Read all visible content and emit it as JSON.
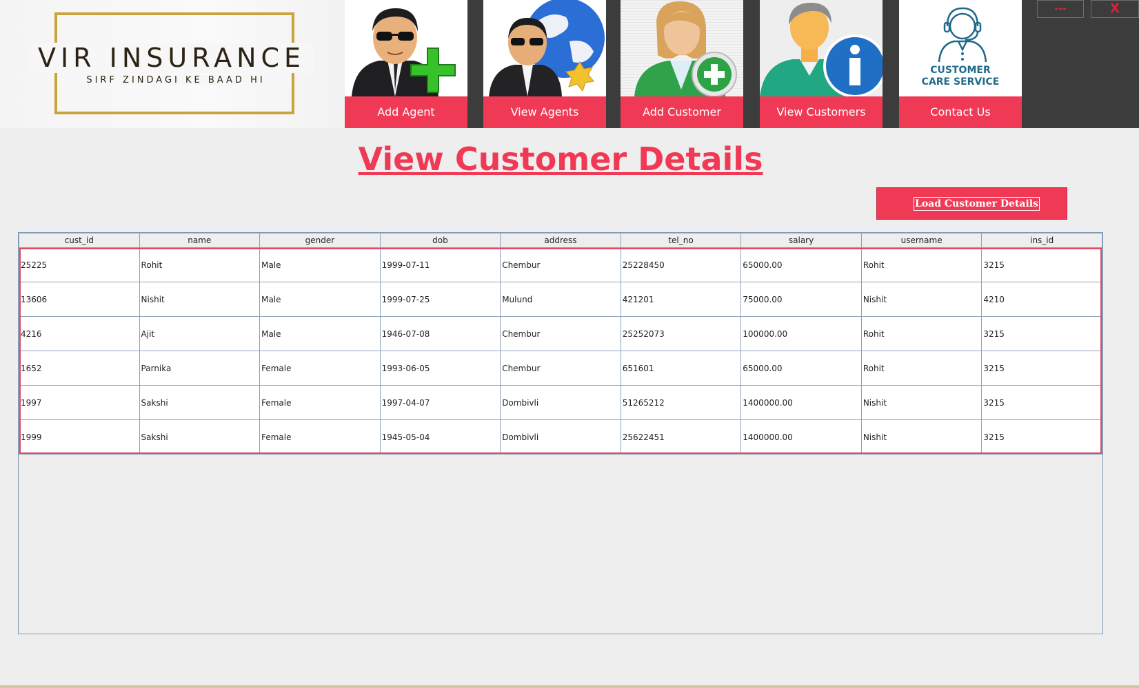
{
  "logo": {
    "title": "VIR INSURANCE",
    "subtitle": "SIRF ZINDAGI KE BAAD HI"
  },
  "nav": [
    {
      "label": "Add Agent",
      "icon": "agent-add-icon"
    },
    {
      "label": "View Agents",
      "icon": "agents-globe-icon"
    },
    {
      "label": "Add Customer",
      "icon": "customer-add-icon"
    },
    {
      "label": "View Customers",
      "icon": "customer-info-icon"
    },
    {
      "label": "Contact Us",
      "icon": "customer-care-icon",
      "caption": [
        "CUSTOMER",
        "CARE SERVICE"
      ]
    }
  ],
  "window": {
    "minimize_label": "---",
    "close_label": "X"
  },
  "page": {
    "title": "View Customer Details",
    "load_button": "Load Customer Details"
  },
  "table": {
    "columns": [
      "cust_id",
      "name",
      "gender",
      "dob",
      "address",
      "tel_no",
      "salary",
      "username",
      "ins_id"
    ],
    "rows": [
      [
        "25225",
        "Rohit",
        "Male",
        "1999-07-11",
        "Chembur",
        "25228450",
        "65000.00",
        "Rohit",
        "3215"
      ],
      [
        "13606",
        "Nishit",
        "Male",
        "1999-07-25",
        "Mulund",
        "421201",
        "75000.00",
        "Nishit",
        "4210"
      ],
      [
        "4216",
        "Ajit",
        "Male",
        "1946-07-08",
        "Chembur",
        "25252073",
        "100000.00",
        "Rohit",
        "3215"
      ],
      [
        "1652",
        "Parnika",
        "Female",
        "1993-06-05",
        "Chembur",
        "651601",
        "65000.00",
        "Rohit",
        "3215"
      ],
      [
        "1997",
        "Sakshi",
        "Female",
        "1997-04-07",
        "Dombivli",
        "51265212",
        "1400000.00",
        "Nishit",
        "3215"
      ],
      [
        "1999",
        "Sakshi",
        "Female",
        "1945-05-04",
        "Dombivli",
        "25622451",
        "1400000.00",
        "Nishit",
        "3215"
      ]
    ]
  },
  "colors": {
    "accent": "#f03a55",
    "dark": "#3c3c3c",
    "gold": "#c9a43c"
  }
}
